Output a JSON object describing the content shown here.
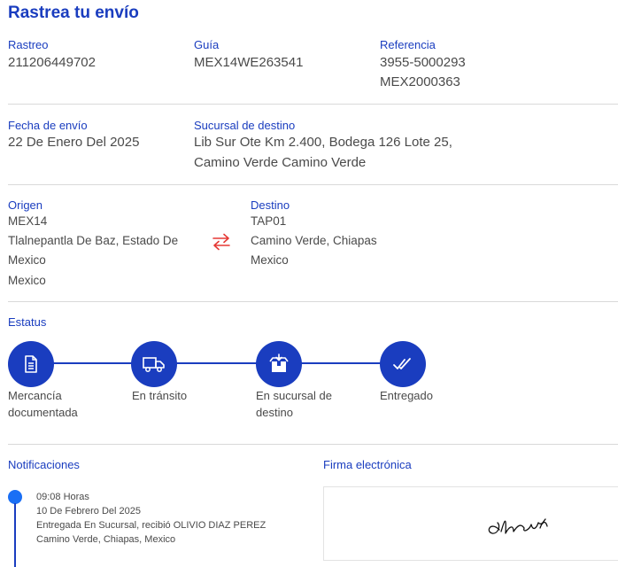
{
  "page": {
    "title": "Rastrea tu envío"
  },
  "tracking": {
    "rastreo_label": "Rastreo",
    "rastreo_value": "211206449702",
    "guia_label": "Guía",
    "guia_value": "MEX14WE263541",
    "referencia_label": "Referencia",
    "referencia_values": [
      "3955-5000293",
      "MEX2000363"
    ]
  },
  "shipment": {
    "fecha_label": "Fecha de envío",
    "fecha_value": "22 De Enero Del 2025",
    "sucursal_label": "Sucursal de destino",
    "sucursal_lines": [
      "Lib Sur Ote Km 2.400, Bodega 126 Lote 25,",
      "Camino Verde Camino Verde"
    ]
  },
  "route": {
    "origen_label": "Origen",
    "origen_code": "MEX14",
    "origen_lines": [
      "Tlalnepantla De Baz, Estado De",
      "Mexico",
      "Mexico"
    ],
    "destino_label": "Destino",
    "destino_code": "TAP01",
    "destino_lines": [
      "Camino Verde, Chiapas",
      "Mexico"
    ],
    "swap_icon": "swap-arrows-icon"
  },
  "status": {
    "label": "Estatus",
    "steps": [
      {
        "icon": "document-icon",
        "label_lines": [
          "Mercancía",
          "documentada"
        ]
      },
      {
        "icon": "truck-icon",
        "label_lines": [
          "En tránsito"
        ]
      },
      {
        "icon": "box-icon",
        "label_lines": [
          "En sucursal de",
          "destino"
        ]
      },
      {
        "icon": "double-check-icon",
        "label_lines": [
          "Entregado"
        ]
      }
    ],
    "color": "#1a3dbf"
  },
  "notifications": {
    "label": "Notificaciones",
    "items": [
      {
        "time": "09:08 Horas",
        "date": "10 De Febrero Del 2025",
        "message": "Entregada En Sucursal, recibió OLIVIO DIAZ PEREZ",
        "location": "Camino Verde, Chiapas, Mexico"
      }
    ]
  },
  "signature": {
    "label": "Firma electrónica"
  },
  "colors": {
    "accent": "#1a3dbf",
    "dot": "#1a6ff5",
    "divider": "#d9d9d9"
  }
}
